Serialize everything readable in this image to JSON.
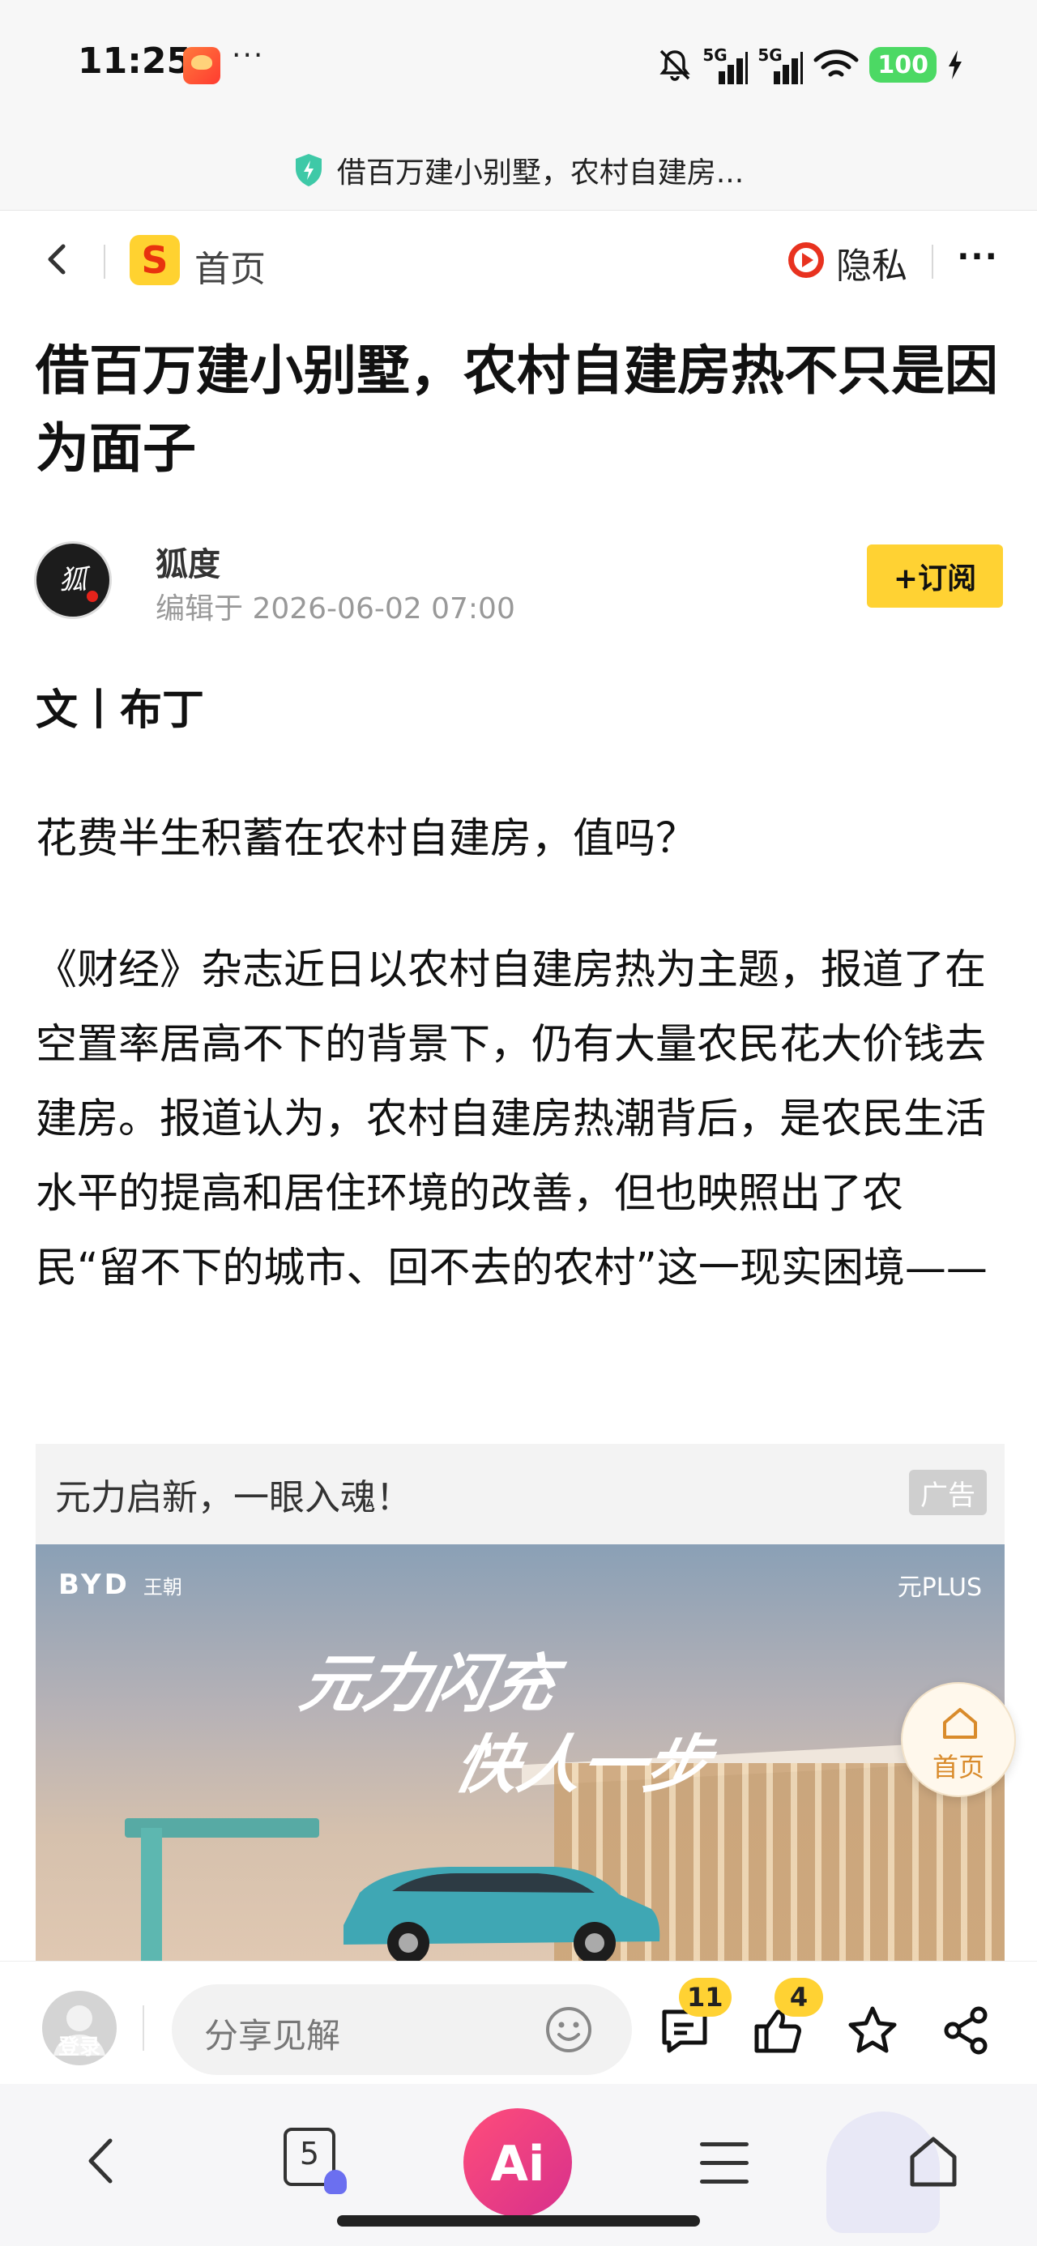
{
  "status_bar": {
    "time": "11:25",
    "more": "···",
    "signal1_label": "5G",
    "signal2_label": "5G",
    "battery": "100"
  },
  "url_bar": {
    "title": "借百万建小别墅，农村自建房..."
  },
  "nav": {
    "home_label": "首页",
    "privacy_label": "隐私",
    "more": "···"
  },
  "article": {
    "title": "借百万建小别墅，农村自建房热不只是因为面子",
    "author": "狐度",
    "edit_time": "编辑于 2026-06-02 07:00",
    "subscribe_label": "+订阅",
    "byline": "文丨布丁",
    "paragraph1": "花费半生积蓄在农村自建房，值吗？",
    "paragraph2": "《财经》杂志近日以农村自建房热为主题，报道了在空置率居高不下的背景下，仍有大量农民花大价钱去建房。报道认为，农村自建房热潮背后，是农民生活水平的提高和居住环境的改善，但也映照出了农民“留不下的城市、回不去的农村”这一现实困境——"
  },
  "ad": {
    "title": "元力启新，一眼入魂！",
    "badge": "广告",
    "brand": "BYD",
    "brand_sub": "王朝",
    "model": "元PLUS",
    "slogan_line1": "元力闪充",
    "slogan_line2": "快人一步"
  },
  "floating_home": {
    "label": "首页"
  },
  "comment_bar": {
    "login_label": "登录",
    "input_placeholder": "分享见解",
    "comment_count": "11",
    "like_count": "4"
  },
  "system_nav": {
    "tab_count": "5",
    "ai_label": "Ai"
  },
  "colors": {
    "accent_yellow": "#ffd233",
    "ai_pink": "#e6377f",
    "home_orange": "#d98b2b"
  }
}
